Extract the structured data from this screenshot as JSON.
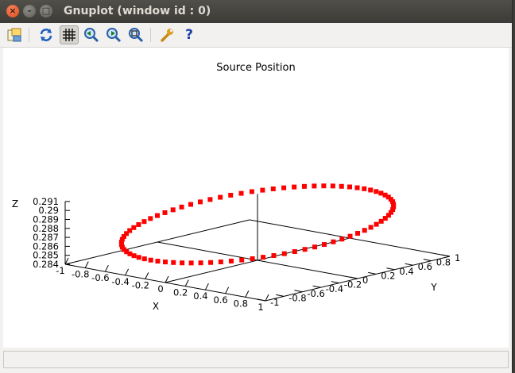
{
  "window": {
    "title": "Gnuplot (window id : 0)",
    "close_label": "×",
    "min_label": "–",
    "max_label": "□"
  },
  "toolbar": {
    "items": [
      {
        "icon": "export-icon"
      },
      {
        "icon": "replot-icon"
      },
      {
        "icon": "grid-icon",
        "active": true
      },
      {
        "icon": "zoom-previous-icon"
      },
      {
        "icon": "zoom-next-icon"
      },
      {
        "icon": "autoscale-icon"
      },
      {
        "icon": "settings-wrench-icon"
      },
      {
        "icon": "help-icon",
        "label": "?"
      }
    ]
  },
  "chart_data": {
    "type": "scatter",
    "title": "Source Position",
    "xlabel": "X",
    "ylabel": "Y",
    "zlabel": "Z",
    "xlim": [
      -1,
      1
    ],
    "ylim": [
      -1,
      1
    ],
    "zlim": [
      0.284,
      0.291
    ],
    "x_ticks": [
      "-1",
      "-0.8",
      "-0.6",
      "-0.4",
      "-0.2",
      "0",
      "0.2",
      "0.4",
      "0.6",
      "0.8",
      "1"
    ],
    "y_ticks": [
      "-1",
      "-0.8",
      "-0.6",
      "-0.4",
      "-0.2",
      "0",
      "0.2",
      "0.4",
      "0.6",
      "0.8",
      "1"
    ],
    "z_ticks": [
      "0.284",
      "0.285",
      "0.286",
      "0.287",
      "0.288",
      "0.289",
      "0.29",
      "0.291"
    ],
    "series": [
      {
        "shape": "circle",
        "center": [
          0,
          0
        ],
        "radius": 1,
        "z": 0.288,
        "z_amplitude": 0.002,
        "count": 80,
        "color": "#ff0000"
      }
    ],
    "grid": false,
    "legend": "none"
  }
}
